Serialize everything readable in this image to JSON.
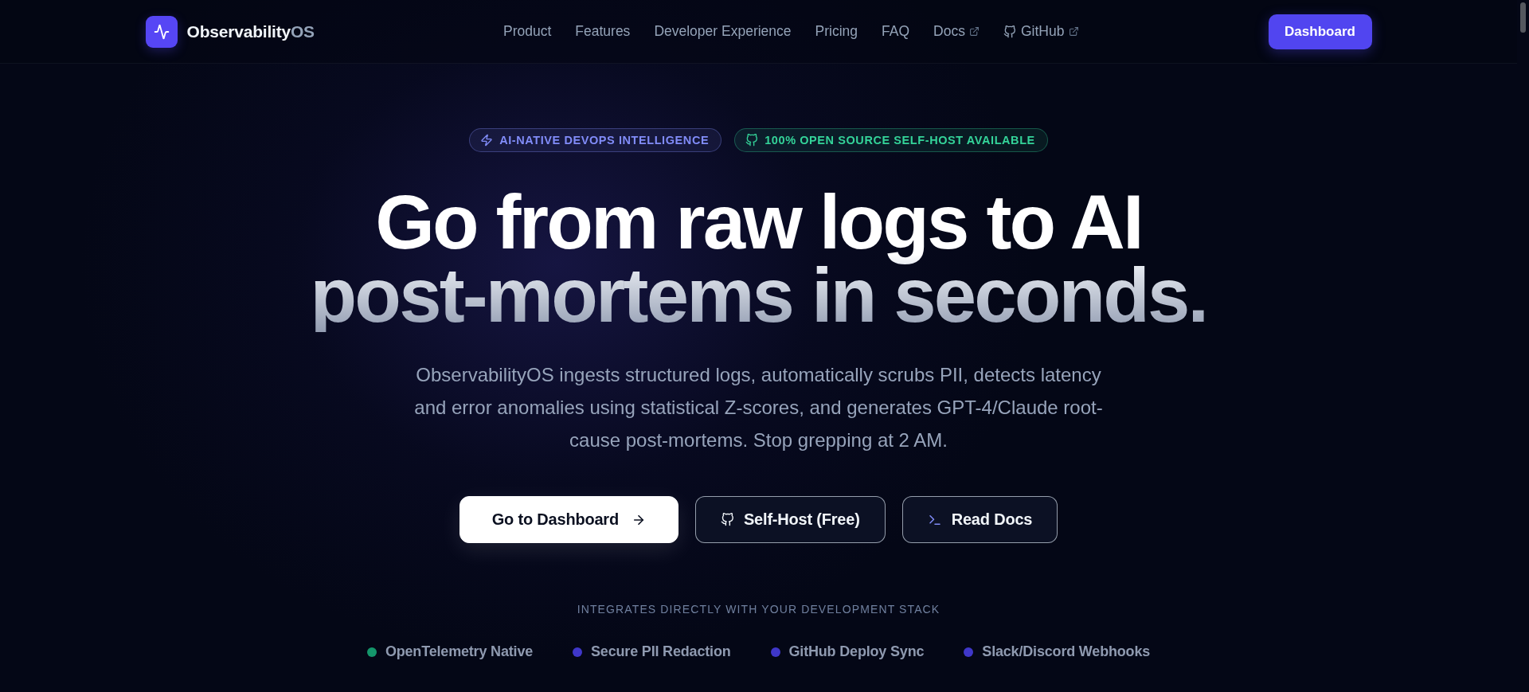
{
  "nav": {
    "brand": {
      "name": "Observability",
      "suffix": "OS"
    },
    "links": [
      {
        "label": "Product",
        "kind": "plain"
      },
      {
        "label": "Features",
        "kind": "plain"
      },
      {
        "label": "Developer Experience",
        "kind": "plain"
      },
      {
        "label": "Pricing",
        "kind": "plain"
      },
      {
        "label": "FAQ",
        "kind": "plain"
      },
      {
        "label": "Docs",
        "kind": "external"
      },
      {
        "label": "GitHub",
        "kind": "repository"
      }
    ],
    "action": "Dashboard"
  },
  "hero": {
    "badges": [
      {
        "label": "AI-NATIVE DEVOPS INTELLIGENCE",
        "kind": "ai",
        "color": "#818cf8"
      },
      {
        "label": "100% OPEN SOURCE SELF-HOST AVAILABLE",
        "kind": "opensource",
        "color": "#34d399"
      }
    ],
    "headline": "Go from raw logs to AI post-mortems in seconds.",
    "description": "ObservabilityOS ingests structured logs, automatically scrubs PII, detects latency and error anomalies using statistical Z-scores, and generates GPT-4/Claude root-cause post-mortems. Stop grepping at 2 AM.",
    "buttons": [
      {
        "label": "Go to Dashboard",
        "kind": "primary"
      },
      {
        "label": "Self-Host (Free)",
        "kind": "repository"
      },
      {
        "label": "Read Docs",
        "kind": "terminal"
      }
    ]
  },
  "integrations": {
    "title": "INTEGRATES DIRECTLY WITH YOUR DEVELOPMENT STACK",
    "items": [
      {
        "label": "OpenTelemetry Native",
        "color": "#14966b"
      },
      {
        "label": "Secure PII Redaction",
        "color": "#3f37c9"
      },
      {
        "label": "GitHub Deploy Sync",
        "color": "#3f37c9"
      },
      {
        "label": "Slack/Discord Webhooks",
        "color": "#3f37c9"
      }
    ]
  }
}
